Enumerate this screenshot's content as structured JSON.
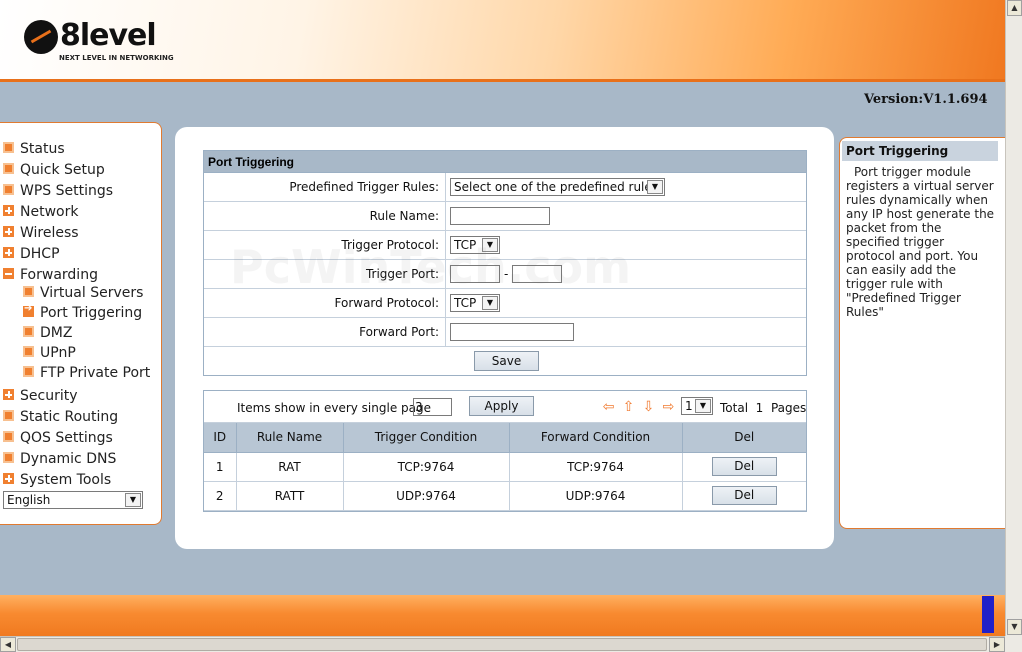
{
  "header": {
    "brand": "8level",
    "tagline": "NEXT LEVEL IN NETWORKING",
    "version": "Version:V1.1.694"
  },
  "nav": {
    "items": [
      {
        "label": "Status",
        "icon": "dot-icon"
      },
      {
        "label": "Quick Setup",
        "icon": "dot-icon"
      },
      {
        "label": "WPS Settings",
        "icon": "dot-icon"
      },
      {
        "label": "Network",
        "icon": "plus-icon"
      },
      {
        "label": "Wireless",
        "icon": "plus-icon"
      },
      {
        "label": "DHCP",
        "icon": "plus-icon"
      },
      {
        "label": "Forwarding",
        "icon": "minus-icon"
      },
      {
        "label": "Virtual Servers",
        "icon": "dot-icon"
      },
      {
        "label": "Port Triggering",
        "icon": "arrow-icon"
      },
      {
        "label": "DMZ",
        "icon": "dot-icon"
      },
      {
        "label": "UPnP",
        "icon": "dot-icon"
      },
      {
        "label": "FTP Private Port",
        "icon": "dot-icon"
      },
      {
        "label": "Security",
        "icon": "plus-icon"
      },
      {
        "label": "Static Routing",
        "icon": "dot-icon"
      },
      {
        "label": "QOS Settings",
        "icon": "dot-icon"
      },
      {
        "label": "Dynamic DNS",
        "icon": "dot-icon"
      },
      {
        "label": "System Tools",
        "icon": "plus-icon"
      }
    ],
    "language": "English"
  },
  "form": {
    "title": "Port Triggering",
    "predefined_label": "Predefined Trigger Rules:",
    "predefined_value": "Select one of the predefined rules",
    "rule_name_label": "Rule Name:",
    "rule_name_value": "",
    "trigger_protocol_label": "Trigger Protocol:",
    "trigger_protocol_value": "TCP",
    "trigger_port_label": "Trigger Port:",
    "trigger_port_from": "",
    "trigger_port_to": "",
    "forward_protocol_label": "Forward Protocol:",
    "forward_protocol_value": "TCP",
    "forward_port_label": "Forward Port:",
    "forward_port_value": "",
    "save_label": "Save"
  },
  "list": {
    "items_label": "Items show in every single page",
    "items_value": "3",
    "apply_label": "Apply",
    "page_value": "1",
    "total_label": "Total",
    "total_pages": "1",
    "pages_label": "Pages",
    "columns": [
      "ID",
      "Rule Name",
      "Trigger Condition",
      "Forward Condition",
      "Del"
    ],
    "rows": [
      {
        "id": "1",
        "name": "RAT",
        "trigger": "TCP:9764",
        "forward": "TCP:9764",
        "del": "Del"
      },
      {
        "id": "2",
        "name": "RATT",
        "trigger": "UDP:9764",
        "forward": "UDP:9764",
        "del": "Del"
      }
    ]
  },
  "help": {
    "title": "Port Triggering",
    "text": "Port trigger module registers a virtual server rules dynamically when any IP host generate the packet from the specified trigger protocol and port. You can easily add the trigger rule with \"Predefined Trigger Rules\""
  },
  "watermark": "PcWinTech.com",
  "colors": {
    "accent_orange": "#f07a20",
    "page_bg": "#a8b8c8",
    "header_row": "#b8c6d4"
  }
}
